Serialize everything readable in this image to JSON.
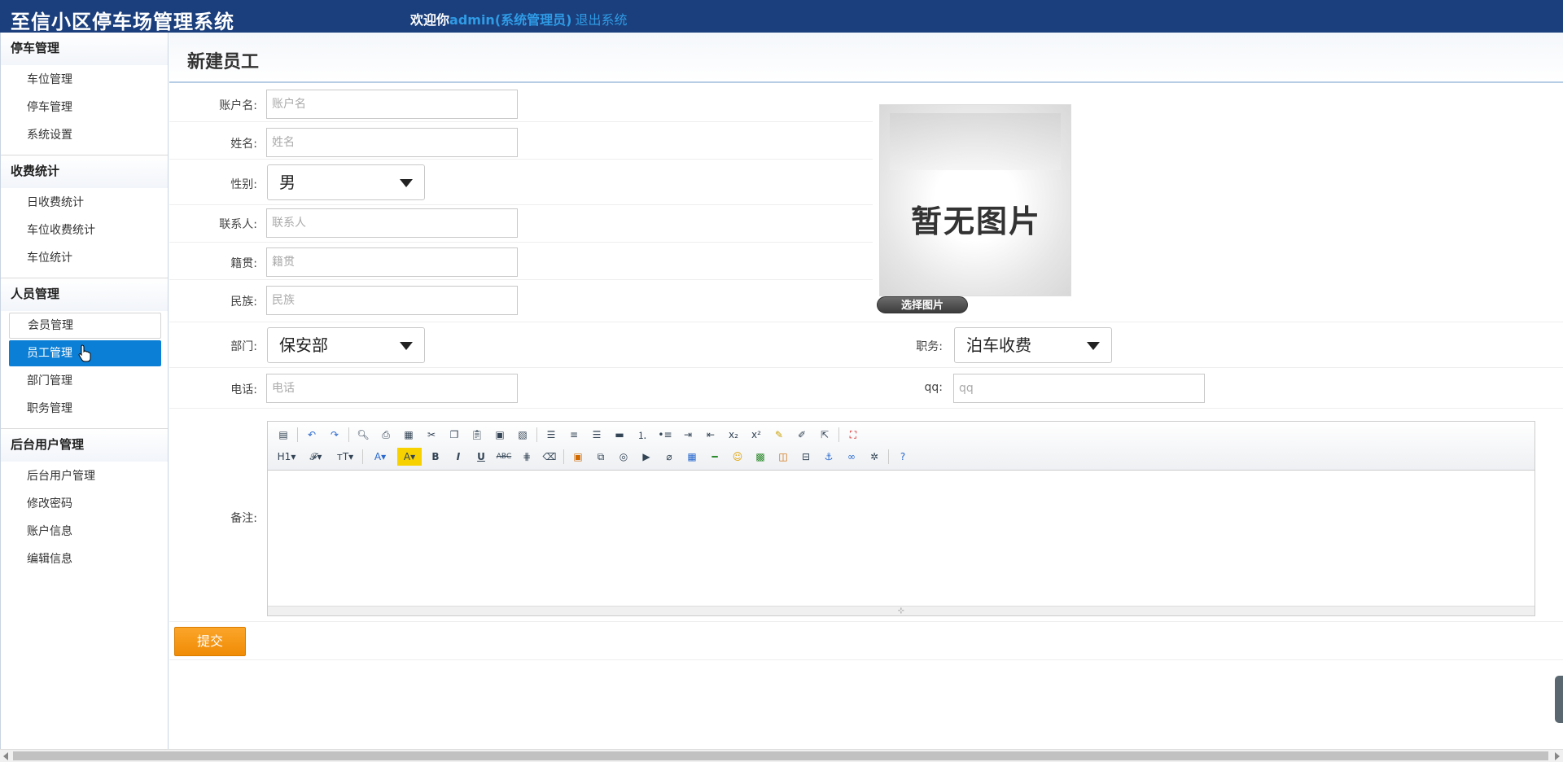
{
  "header": {
    "title": "至信小区停车场管理系统",
    "welcome_prefix": "欢迎你",
    "user": "admin(系统管理员)",
    "logout": "退出系统"
  },
  "sidebar": {
    "groups": [
      {
        "title": "停车管理",
        "items": [
          "车位管理",
          "停车管理",
          "系统设置"
        ]
      },
      {
        "title": "收费统计",
        "items": [
          "日收费统计",
          "车位收费统计",
          "车位统计"
        ]
      },
      {
        "title": "人员管理",
        "items": [
          "会员管理",
          "员工管理",
          "部门管理",
          "职务管理"
        ]
      },
      {
        "title": "后台用户管理",
        "items": [
          "后台用户管理",
          "修改密码",
          "账户信息",
          "编辑信息"
        ]
      }
    ],
    "active_item": "员工管理",
    "hover_item": "会员管理"
  },
  "form": {
    "page_title": "新建员工",
    "account": {
      "label": "账户名:",
      "placeholder": "账户名"
    },
    "name": {
      "label": "姓名:",
      "placeholder": "姓名"
    },
    "gender": {
      "label": "性别:",
      "value": "男"
    },
    "contact": {
      "label": "联系人:",
      "placeholder": "联系人"
    },
    "native": {
      "label": "籍贯:",
      "placeholder": "籍贯"
    },
    "ethnic": {
      "label": "民族:",
      "placeholder": "民族"
    },
    "department": {
      "label": "部门:",
      "value": "保安部"
    },
    "position": {
      "label": "职务:",
      "value": "泊车收费"
    },
    "phone": {
      "label": "电话:",
      "placeholder": "电话"
    },
    "qq": {
      "label": "qq:",
      "placeholder": "qq"
    },
    "remark": {
      "label": "备注:"
    },
    "photo_text": "暂无图片",
    "pick_image": "选择图片",
    "submit": "提交"
  },
  "editor": {
    "row1_icons": [
      "source-icon",
      "undo-icon",
      "redo-icon",
      "preview-icon",
      "print-icon",
      "template-icon",
      "cut-icon",
      "copy-icon",
      "paste-icon",
      "paste-text-icon",
      "paste-word-icon",
      "align-left-icon",
      "align-center-icon",
      "align-right-icon",
      "align-justify-icon",
      "ordered-list-icon",
      "unordered-list-icon",
      "indent-icon",
      "outdent-icon",
      "subscript-icon",
      "superscript-icon",
      "clear-format-icon",
      "quick-format-icon",
      "select-all-icon",
      "fullscreen-icon"
    ],
    "row2_icons": [
      "heading-icon",
      "font-family-icon",
      "font-size-icon",
      "font-color-icon",
      "highlight-icon",
      "bold-icon",
      "italic-icon",
      "underline-icon",
      "strikethrough-icon",
      "line-height-icon",
      "remove-format-icon",
      "image-icon",
      "multi-image-icon",
      "flash-icon",
      "media-icon",
      "attachment-icon",
      "table-icon",
      "hr-icon",
      "emoticon-icon",
      "map-icon",
      "code-icon",
      "pagebreak-icon",
      "anchor-icon",
      "link-icon",
      "unlink-icon",
      "help-icon"
    ]
  }
}
